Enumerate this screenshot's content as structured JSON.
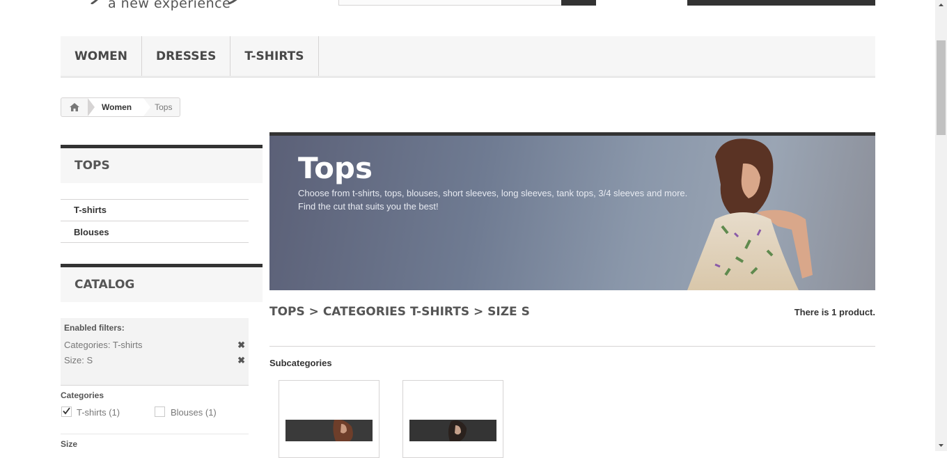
{
  "logo": {
    "tagline": "a new experience"
  },
  "menu": {
    "items": [
      "Women",
      "Dresses",
      "T-shirts"
    ]
  },
  "breadcrumb": {
    "parent": "Women",
    "current": "Tops"
  },
  "sidebar": {
    "category_block": {
      "title": "Tops",
      "items": [
        "T-shirts",
        "Blouses"
      ]
    },
    "catalog_block": {
      "title": "Catalog",
      "enabled_filters_title": "Enabled filters:",
      "enabled_filters": [
        {
          "label": "Categories: T-shirts",
          "remove": "✖"
        },
        {
          "label": "Size: S",
          "remove": "✖"
        }
      ],
      "categories_title": "Categories",
      "categories": [
        {
          "label": "T-shirts (1)",
          "checked": true
        },
        {
          "label": "Blouses (1)",
          "checked": false
        }
      ],
      "size_title": "Size"
    }
  },
  "banner": {
    "title": "Tops",
    "description_line1": "Choose from t-shirts, tops, blouses, short sleeves, long sleeves, tank tops, 3/4 sleeves and more.",
    "description_line2": "Find the cut that suits you the best!"
  },
  "category_heading": "Tops > Categories T-shirts > Size S",
  "product_count": {
    "prefix": "There is ",
    "count": "1",
    "suffix": " product."
  },
  "subcategories": {
    "label": "Subcategories"
  },
  "colors": {
    "accent_dark": "#333333",
    "menu_bg": "#f6f6f6",
    "border": "#d6d4d4"
  }
}
